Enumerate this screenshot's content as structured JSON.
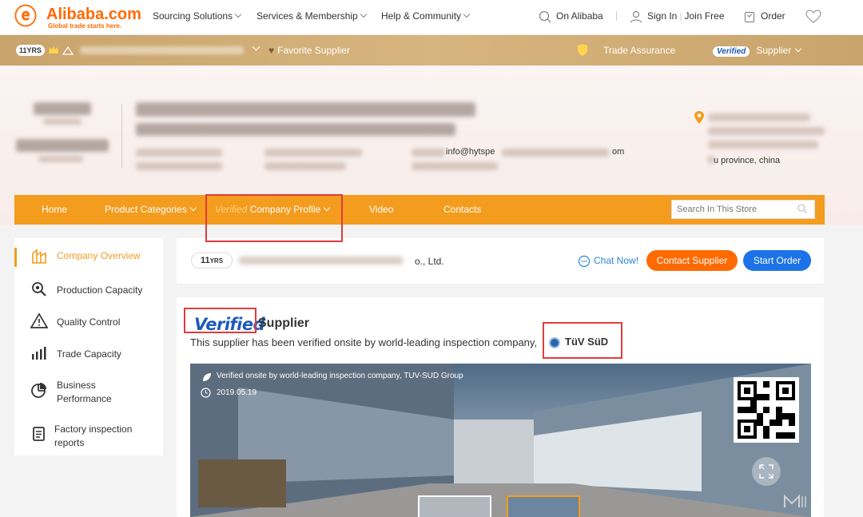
{
  "header": {
    "logo_name": "Alibaba.com",
    "logo_tagline": "Global trade starts here.",
    "nav": [
      "Sourcing Solutions",
      "Services & Membership",
      "Help & Community"
    ],
    "search_label": "On Alibaba",
    "sign_in": "Sign In",
    "join_free": "Join Free",
    "order": "Order"
  },
  "supplier_bar": {
    "years_badge": "11YRS",
    "favorite": "Favorite Supplier",
    "trade_assurance": "Trade Assurance",
    "verified_badge": "Verified",
    "supplier": "Supplier"
  },
  "hero": {
    "email_fragment": "info@hytspe",
    "email_tail": "om",
    "province": "u province, china"
  },
  "store_nav": {
    "home": "Home",
    "product_categories": "Product Categories",
    "verified_prefix": "Verified",
    "company_profile": "Company Profile",
    "video": "Video",
    "contacts": "Contacts",
    "search_placeholder": "Search In This Store"
  },
  "sidebar": {
    "items": [
      {
        "label": "Company Overview",
        "icon": "factory-icon",
        "active": true
      },
      {
        "label": "Production Capacity",
        "icon": "magnifier-icon",
        "active": false
      },
      {
        "label": "Quality Control",
        "icon": "warning-triangle-icon",
        "active": false
      },
      {
        "label": "Trade Capacity",
        "icon": "bar-chart-icon",
        "active": false
      },
      {
        "label": "Business Performance",
        "icon": "pie-chart-icon",
        "active": false
      },
      {
        "label": "Factory inspection reports",
        "icon": "document-icon",
        "active": false
      }
    ]
  },
  "company_card": {
    "years": "11",
    "years_unit": "YRS",
    "name_fragment": "o., Ltd.",
    "chat": "Chat Now!",
    "contact_button": "Contact Supplier",
    "order_button": "Start Order"
  },
  "verification": {
    "logo": "Verified",
    "title": "Supplier",
    "description": "This supplier has been verified onsite by world-leading inspection company,",
    "inspector": "TüV SüD",
    "photo_caption": "Verified onsite by world-leading inspection company, TUV-SUD Group",
    "photo_date": "2019.05.19"
  },
  "colors": {
    "orange": "#f39c1e",
    "brand_orange": "#ff6a00",
    "blue": "#1c73e8",
    "gold": "#c9a46c",
    "callout_red": "#e03c3c"
  }
}
